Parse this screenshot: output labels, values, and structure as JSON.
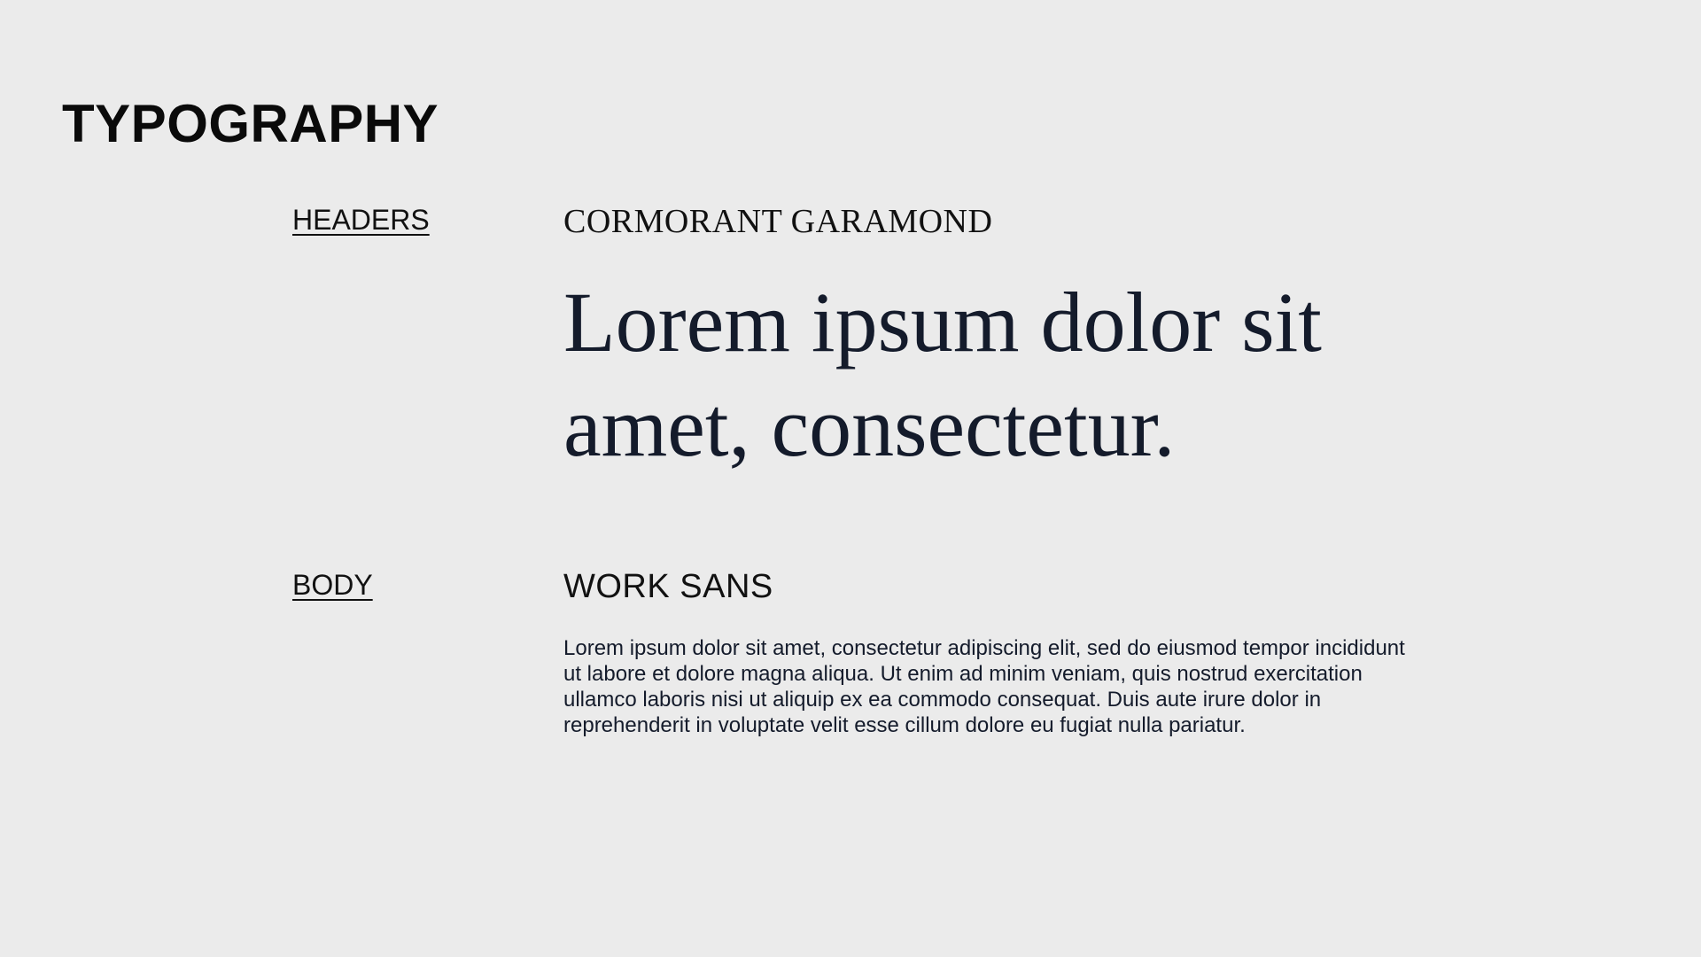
{
  "page": {
    "title": "TYPOGRAPHY",
    "background_color": "#ebebeb"
  },
  "sections": {
    "headers": {
      "label": "HEADERS",
      "font_name": "CORMORANT GARAMOND",
      "sample_text": "Lorem ipsum dolor sit amet, consectetur."
    },
    "body": {
      "label": "BODY",
      "font_name": "WORK SANS",
      "sample_text": "Lorem ipsum dolor sit amet, consectetur adipiscing elit, sed do eiusmod tempor incididunt ut labore et dolore magna aliqua. Ut enim ad minim veniam, quis nostrud exercitation ullamco laboris nisi ut aliquip ex ea commodo consequat. Duis aute irure dolor in reprehenderit in voluptate velit esse cillum dolore eu fugiat nulla pariatur."
    }
  },
  "colors": {
    "text_primary": "#0a0a0a",
    "text_sample": "#141b2b"
  }
}
